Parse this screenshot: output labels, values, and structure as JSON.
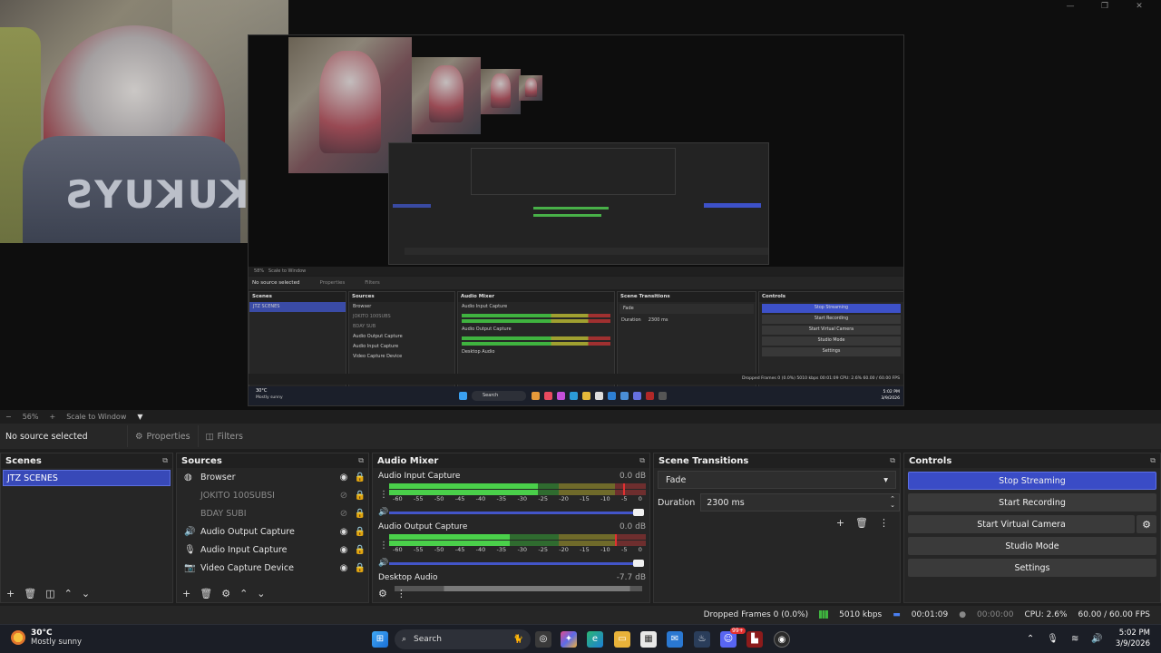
{
  "window": {
    "controls": [
      "—",
      "❐",
      "✕"
    ]
  },
  "preview_nested": {
    "no_source": "No source selected",
    "properties": "Properties",
    "filters": "Filters",
    "zoom": "58%",
    "scale": "Scale to Window",
    "scenes_title": "Scenes",
    "sources_title": "Sources",
    "mixer_title": "Audio Mixer",
    "transitions_title": "Scene Transitions",
    "controls_title": "Controls",
    "scene_item": "JTZ SCENES",
    "sources": [
      "Browser",
      "JOKITO 100SUBS",
      "BDAY SUB",
      "Audio Output Capture",
      "Audio Input Capture",
      "Video Capture Device"
    ],
    "mixer": [
      "Audio Input Capture",
      "Audio Output Capture",
      "Desktop Audio"
    ],
    "fade": "Fade",
    "duration_label": "Duration",
    "duration": "2300 ms",
    "buttons": [
      "Stop Streaming",
      "Start Recording",
      "Start Virtual Camera",
      "Studio Mode",
      "Settings"
    ],
    "status": "Dropped Frames 0 (0.0%)    5010 kbps    00:01:09    CPU: 2.6%    60.00 / 60.00 FPS",
    "temp": "30°C",
    "cond": "Mostly sunny",
    "search": "Search",
    "time": "5:02 PM",
    "date": "3/9/2026"
  },
  "zoombar": {
    "minus": "−",
    "zoom": "56%",
    "plus": "+",
    "scale": "Scale to Window",
    "caret": "▼"
  },
  "propbar": {
    "no_source": "No source selected",
    "properties": "Properties",
    "filters": "Filters"
  },
  "scenes": {
    "title": "Scenes",
    "items": [
      "JTZ SCENES"
    ]
  },
  "sources": {
    "title": "Sources",
    "items": [
      {
        "label": "Browser",
        "icon": "globe-icon",
        "visible": true
      },
      {
        "label": "JOKITO 100SUBSI",
        "icon": "none",
        "visible": false
      },
      {
        "label": "BDAY SUBI",
        "icon": "none",
        "visible": false
      },
      {
        "label": "Audio Output Capture",
        "icon": "speaker-icon",
        "visible": true
      },
      {
        "label": "Audio Input Capture",
        "icon": "microphone-icon",
        "visible": true
      },
      {
        "label": "Video Capture Device",
        "icon": "camera-icon",
        "visible": true
      }
    ]
  },
  "mixer": {
    "title": "Audio Mixer",
    "ticks": [
      "-60",
      "-55",
      "-50",
      "-45",
      "-40",
      "-35",
      "-30",
      "-25",
      "-20",
      "-15",
      "-10",
      "-5",
      "0"
    ],
    "channels": [
      {
        "name": "Audio Input Capture",
        "db": "0.0 dB",
        "level": 0.58,
        "peak": 0.91
      },
      {
        "name": "Audio Output Capture",
        "db": "0.0 dB",
        "level": 0.47,
        "peak": 0.88
      },
      {
        "name": "Desktop Audio",
        "db": "-7.7 dB"
      }
    ]
  },
  "transitions": {
    "title": "Scene Transitions",
    "type": "Fade",
    "duration_label": "Duration",
    "duration": "2300 ms"
  },
  "controls": {
    "title": "Controls",
    "stop_streaming": "Stop Streaming",
    "start_recording": "Start Recording",
    "start_virtual_camera": "Start Virtual Camera",
    "studio_mode": "Studio Mode",
    "settings": "Settings"
  },
  "status": {
    "dropped": "Dropped Frames 0 (0.0%)",
    "kbps": "5010 kbps",
    "stream_time": "00:01:09",
    "rec_time": "00:00:00",
    "cpu": "CPU: 2.6%",
    "fps": "60.00 / 60.00 FPS"
  },
  "taskbar": {
    "temp": "30°C",
    "condition": "Mostly sunny",
    "search": "Search",
    "time": "5:02 PM",
    "date": "3/9/2026",
    "badge": "99+"
  },
  "colors": {
    "accent": "#3a4cc6",
    "meter_green": "#4ad04a",
    "meter_yellow": "#a0a030",
    "meter_red": "#e23030"
  }
}
